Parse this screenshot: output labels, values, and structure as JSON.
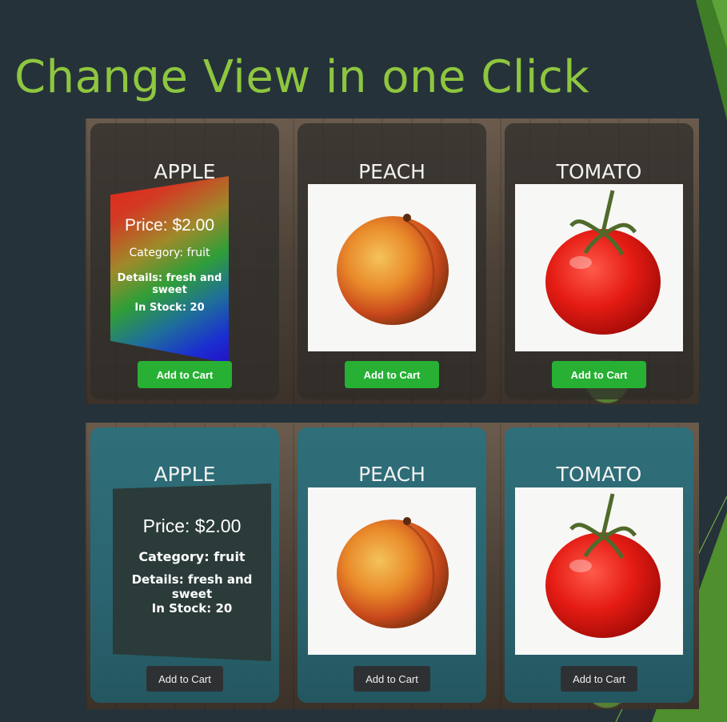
{
  "slide": {
    "title": "Change View in one Click"
  },
  "colors": {
    "title_green": "#8ec63f",
    "slide_bg": "#25323a",
    "cart_green": "#27b034"
  },
  "view_one": {
    "cards": [
      {
        "name": "APPLE",
        "button": "Add to Cart",
        "details": {
          "price": "Price: $2.00",
          "category": "Category: fruit",
          "details": "Details: fresh and sweet",
          "stock": "In Stock: 20"
        }
      },
      {
        "name": "PEACH",
        "button": "Add to Cart",
        "image": "peach"
      },
      {
        "name": "TOMATO",
        "button": "Add to Cart",
        "image": "tomato"
      }
    ]
  },
  "view_two": {
    "cards": [
      {
        "name": "APPLE",
        "button": "Add to Cart",
        "details": {
          "price": "Price: $2.00",
          "category": "Category: fruit",
          "details": "Details: fresh and sweet",
          "stock": "In Stock: 20"
        }
      },
      {
        "name": "PEACH",
        "button": "Add to Cart",
        "image": "peach"
      },
      {
        "name": "TOMATO",
        "button": "Add to Cart",
        "image": "tomato"
      }
    ]
  }
}
